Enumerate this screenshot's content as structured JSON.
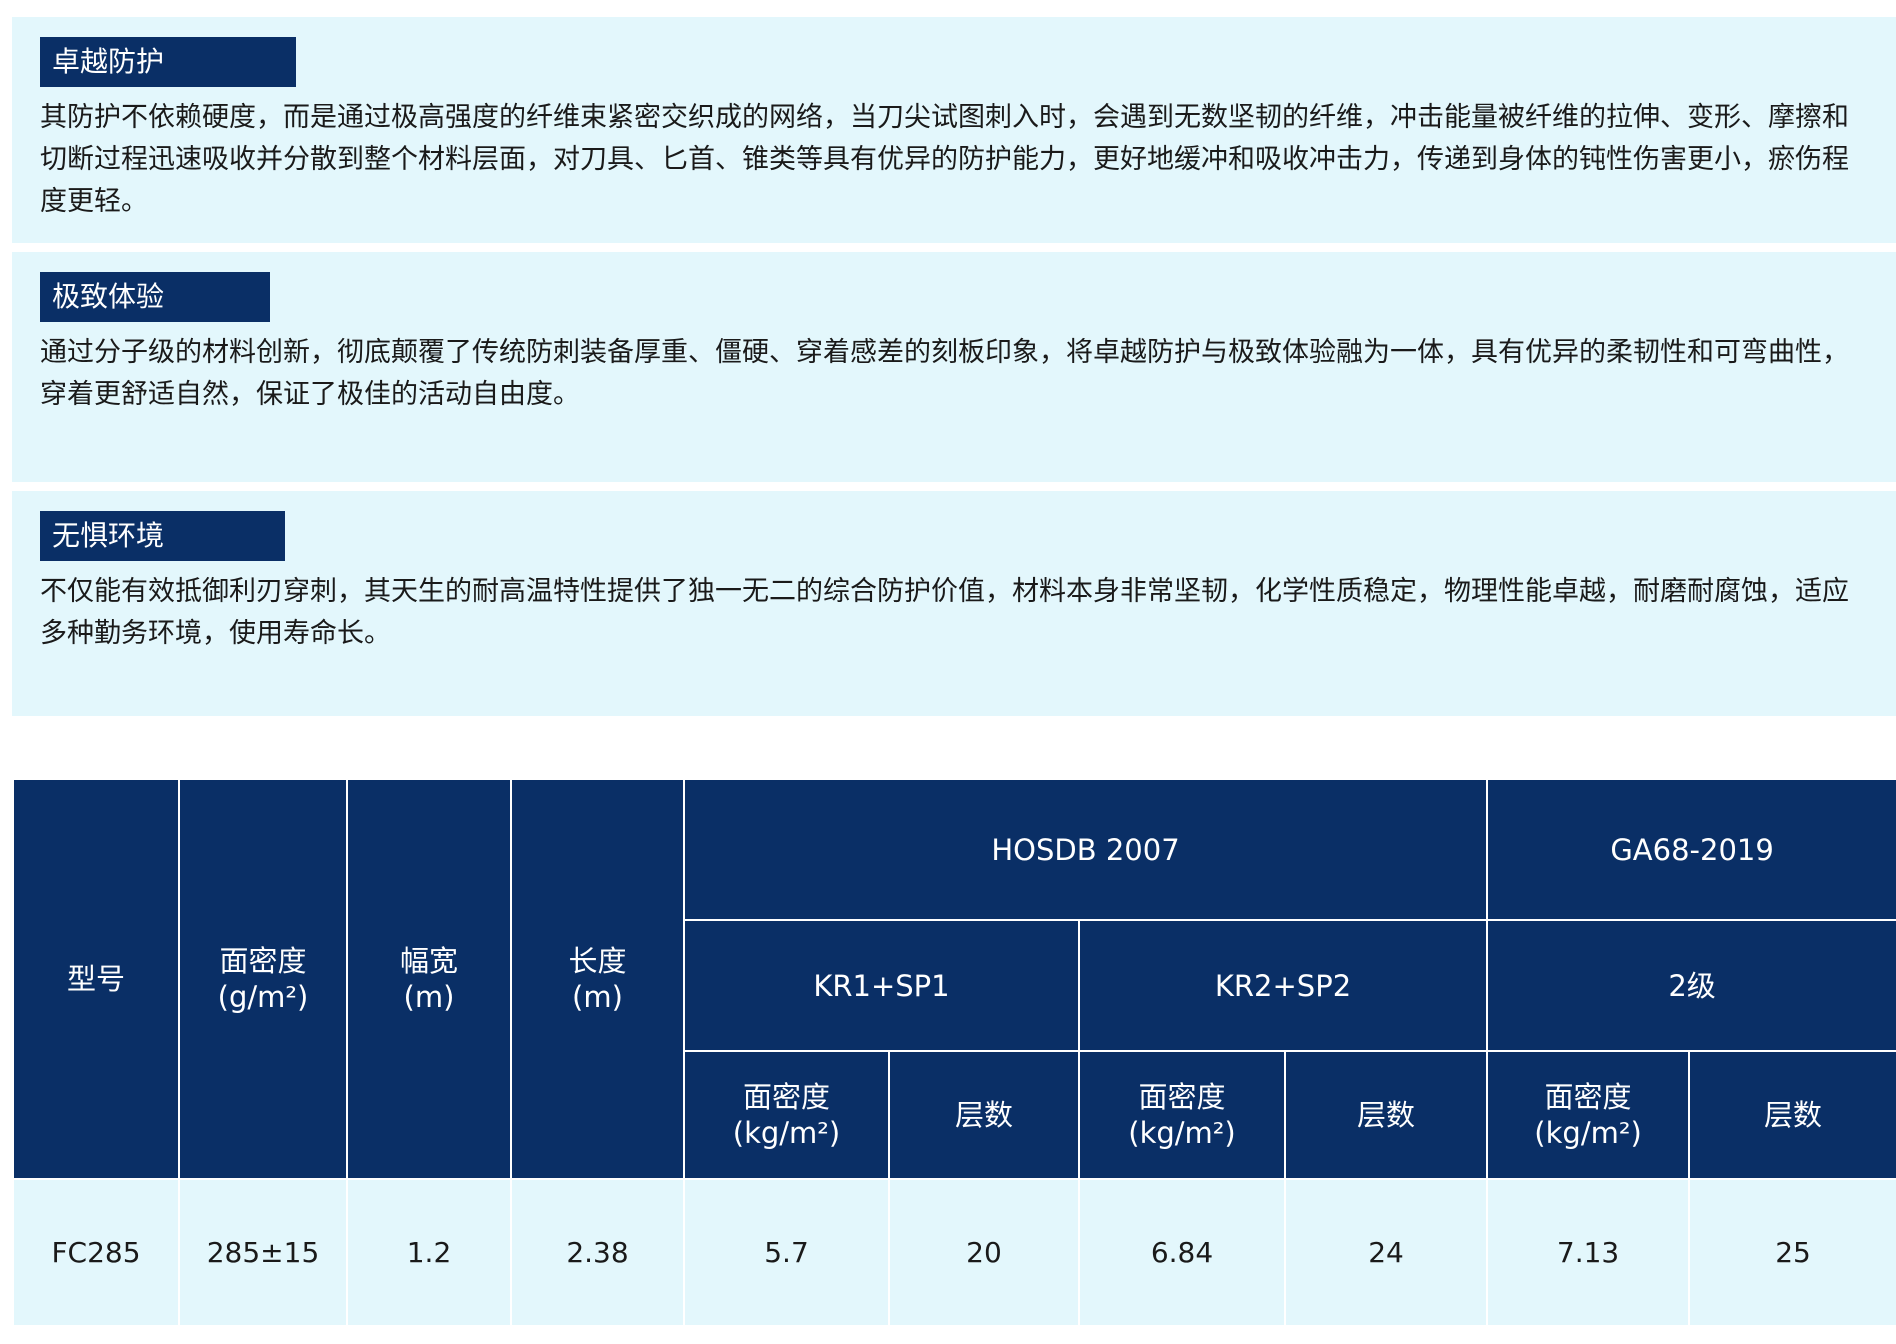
{
  "features": [
    {
      "title": "卓越防护",
      "text": "其防护不依赖硬度，而是通过极高强度的纤维束紧密交织成的网络，当刀尖试图刺入时，会遇到无数坚韧的纤维，冲击能量被纤维的拉伸、变形、摩擦和切断过程迅速吸收并分散到整个材料层面，对刀具、匕首、锥类等具有优异的防护能力，更好地缓冲和吸收冲击力，传递到身体的钝性伤害更小，瘀伤程度更轻。"
    },
    {
      "title": "极致体验",
      "text": "通过分子级的材料创新，彻底颠覆了传统防刺装备厚重、僵硬、穿着感差的刻板印象，将卓越防护与极致体验融为一体，具有优异的柔韧性和可弯曲性，穿着更舒适自然，保证了极佳的活动自由度。"
    },
    {
      "title": "无惧环境",
      "text": "不仅能有效抵御利刃穿刺，其天生的耐高温特性提供了独一无二的综合防护价值，材料本身非常坚韧，化学性质稳定，物理性能卓越，耐磨耐腐蚀，适应多种勤务环境，使用寿命长。"
    }
  ],
  "table": {
    "headers": {
      "model": "型号",
      "areal_density": {
        "line1": "面密度",
        "line2": "(g/m²)"
      },
      "width": {
        "line1": "幅宽",
        "line2": "(m)"
      },
      "length": {
        "line1": "长度",
        "line2": "(m)"
      },
      "std_hosdb": "HOSDB 2007",
      "std_ga": "GA68-2019",
      "level_kr1": "KR1+SP1",
      "level_kr2": "KR2+SP2",
      "level_ga": "2级",
      "sub_density": {
        "line1": "面密度",
        "line2": "(kg/m²)"
      },
      "sub_layers": "层数"
    },
    "rows": [
      {
        "model": "FC285",
        "areal_density": "285±15",
        "width": "1.2",
        "length": "2.38",
        "kr1_density": "5.7",
        "kr1_layers": "20",
        "kr2_density": "6.84",
        "kr2_layers": "24",
        "ga_density": "7.13",
        "ga_layers": "25"
      }
    ]
  }
}
